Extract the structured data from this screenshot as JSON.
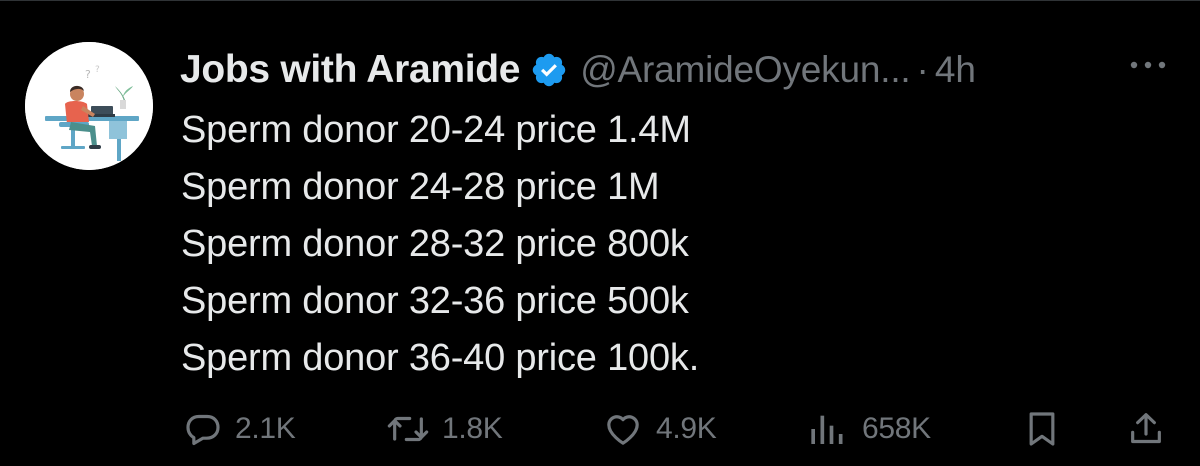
{
  "tweet": {
    "author": {
      "display_name": "Jobs with Aramide",
      "handle": "@AramideOyekun...",
      "verified": true,
      "avatar_icon": "person-at-desk-illustration"
    },
    "separator": "·",
    "timestamp": "4h",
    "body_lines": [
      "Sperm donor 20-24 price 1.4M",
      "Sperm donor 24-28 price 1M",
      "Sperm donor 28-32 price 800k",
      "Sperm donor 32-36 price 500k",
      "Sperm donor 36-40 price 100k."
    ],
    "actions": {
      "reply": {
        "icon": "reply-icon",
        "count": "2.1K"
      },
      "repost": {
        "icon": "repost-icon",
        "count": "1.8K"
      },
      "like": {
        "icon": "heart-icon",
        "count": "4.9K"
      },
      "views": {
        "icon": "views-icon",
        "count": "658K"
      },
      "bookmark": {
        "icon": "bookmark-icon"
      },
      "share": {
        "icon": "share-icon"
      }
    }
  },
  "colors": {
    "background": "#000000",
    "primary_text": "#e7e9ea",
    "secondary_text": "#71767b",
    "verified_badge": "#1d9bf0"
  }
}
